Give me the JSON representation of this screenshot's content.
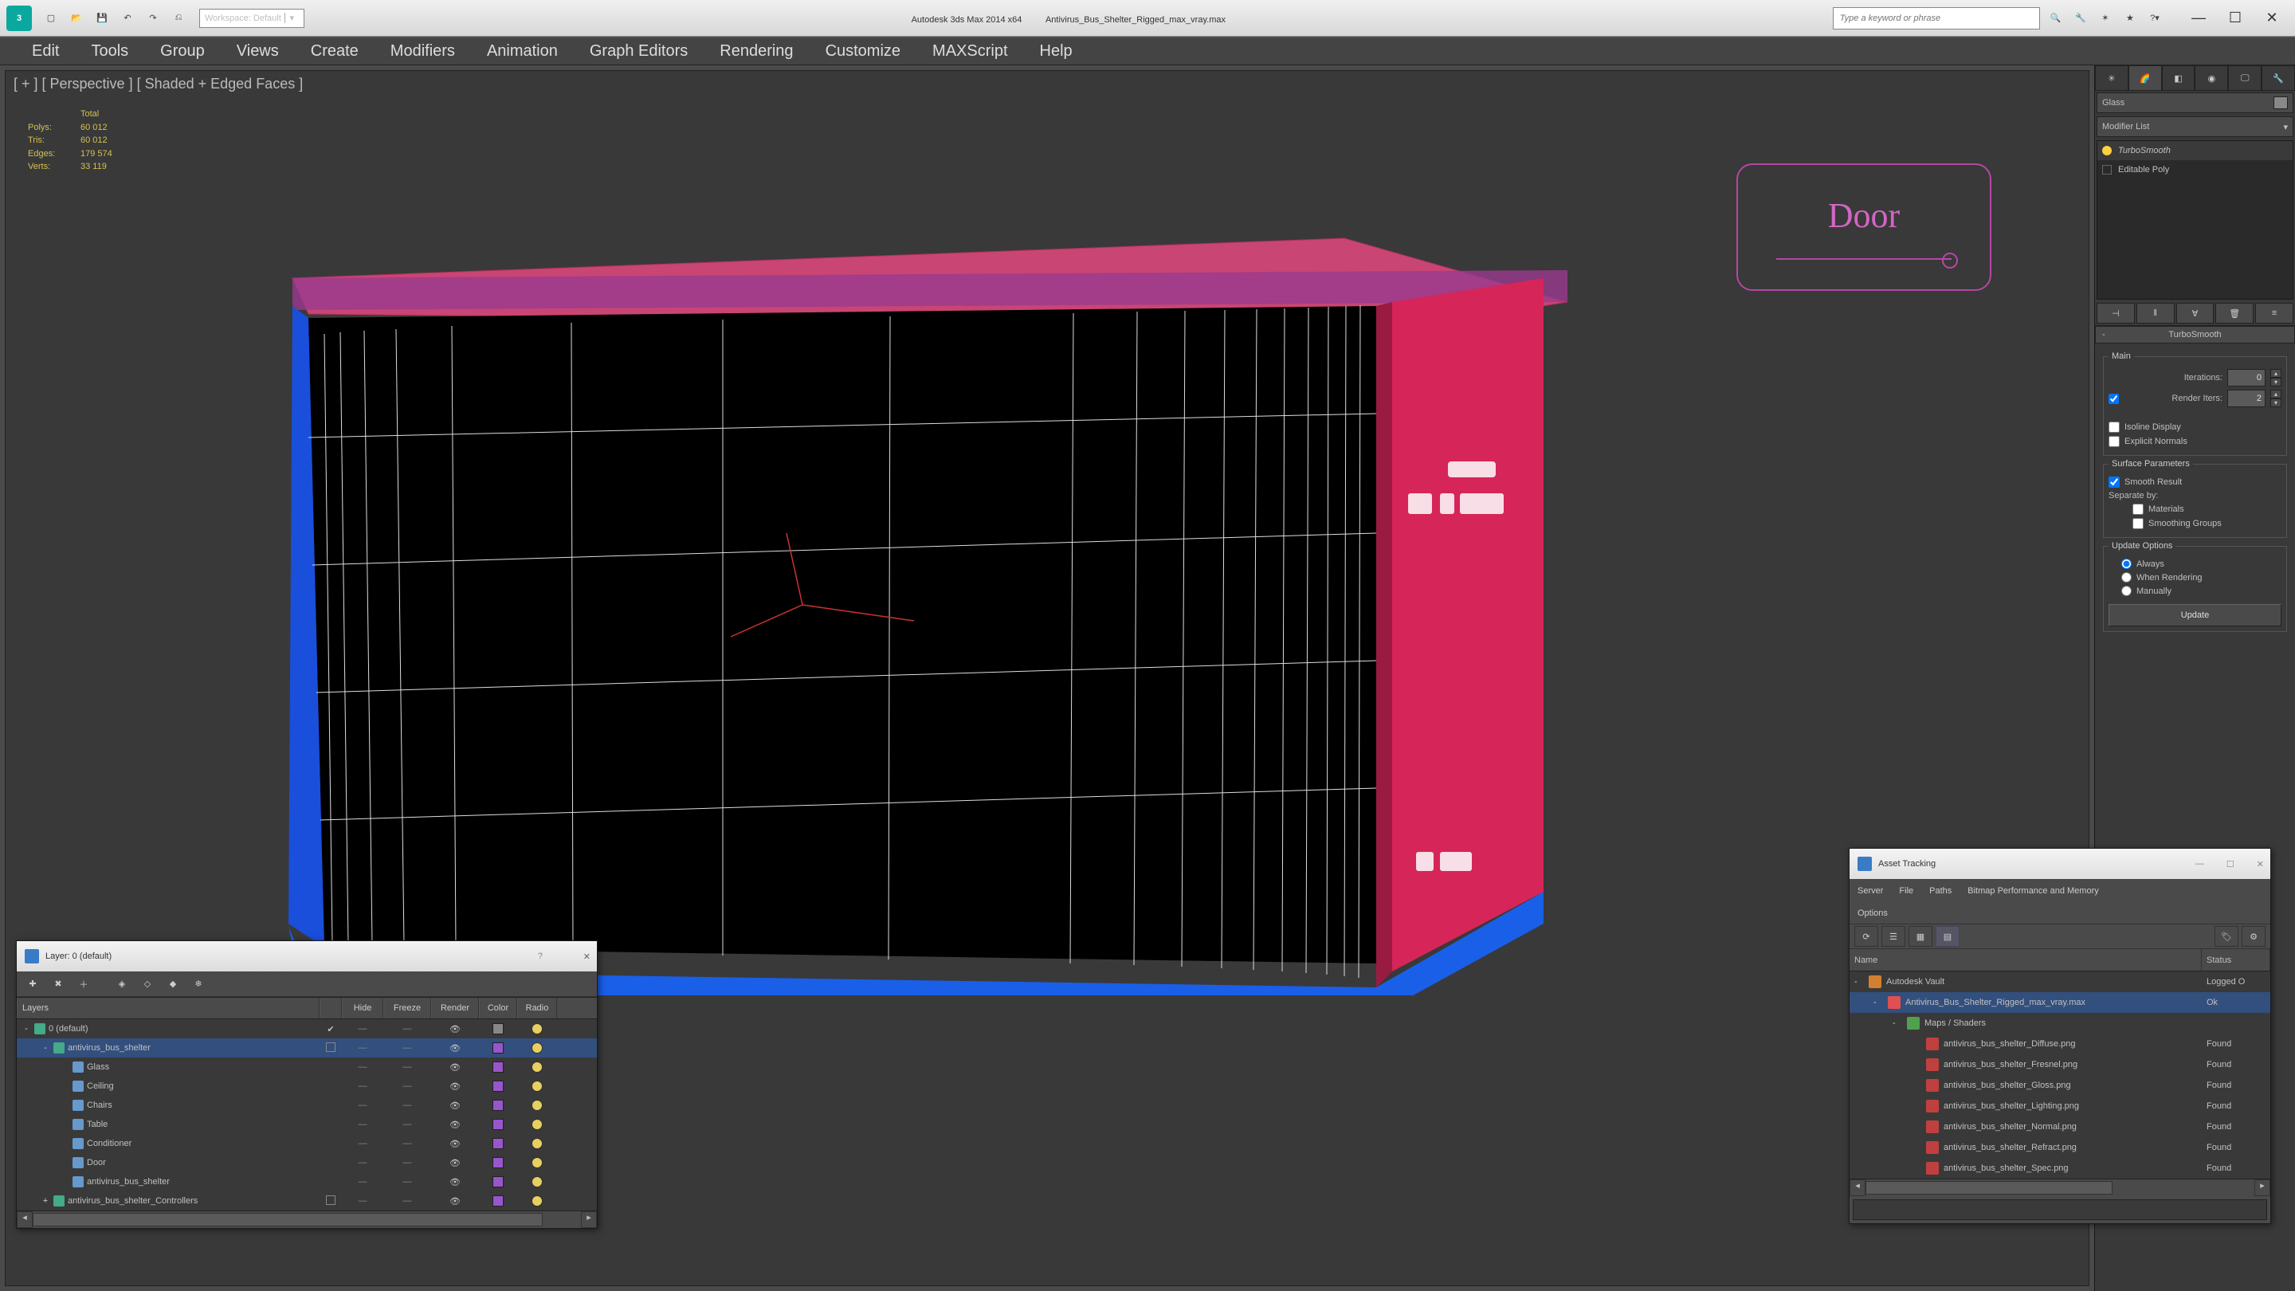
{
  "titlebar": {
    "workspace_selector": "Workspace: Default",
    "app_name": "Autodesk 3ds Max  2014 x64",
    "file_name": "Antivirus_Bus_Shelter_Rigged_max_vray.max",
    "search_placeholder": "Type a keyword or phrase"
  },
  "menubar": [
    "Edit",
    "Tools",
    "Group",
    "Views",
    "Create",
    "Modifiers",
    "Animation",
    "Graph Editors",
    "Rendering",
    "Customize",
    "MAXScript",
    "Help"
  ],
  "viewport": {
    "label": "[ + ] [ Perspective ] [ Shaded + Edged Faces ]",
    "stats_header": "Total",
    "stats": [
      {
        "label": "Polys:",
        "value": "60 012"
      },
      {
        "label": "Tris:",
        "value": "60 012"
      },
      {
        "label": "Edges:",
        "value": "179 574"
      },
      {
        "label": "Verts:",
        "value": "33 119"
      }
    ],
    "viewcube_label": "Door"
  },
  "cmdpanel": {
    "object_name": "Glass",
    "modifier_list_label": "Modifier List",
    "mod_stack": [
      {
        "name": "TurboSmooth",
        "selected": true,
        "italic": true
      },
      {
        "name": "Editable Poly",
        "selected": false,
        "italic": false
      }
    ],
    "rollout_title": "TurboSmooth",
    "main_group": "Main",
    "iterations_label": "Iterations:",
    "iterations_value": "0",
    "render_iters_label": "Render Iters:",
    "render_iters_value": "2",
    "render_iters_checked": true,
    "isoline_label": "Isoline Display",
    "explicit_label": "Explicit Normals",
    "surface_group": "Surface Parameters",
    "smooth_result_label": "Smooth Result",
    "smooth_result_checked": true,
    "separate_label": "Separate by:",
    "materials_label": "Materials",
    "smoothing_groups_label": "Smoothing Groups",
    "update_group": "Update Options",
    "radio_always": "Always",
    "radio_when": "When Rendering",
    "radio_manual": "Manually",
    "update_button": "Update"
  },
  "layers": {
    "title": "Layer: 0 (default)",
    "columns": [
      "Layers",
      "",
      "Hide",
      "Freeze",
      "Render",
      "Color",
      "Radio"
    ],
    "rows": [
      {
        "indent": 0,
        "expand": "-",
        "name": "0 (default)",
        "flagged": true,
        "selected": false,
        "color": "#888888"
      },
      {
        "indent": 1,
        "expand": "-",
        "name": "antivirus_bus_shelter",
        "flagged": false,
        "selected": true,
        "hasbox": true,
        "color": "#9955cc"
      },
      {
        "indent": 2,
        "expand": "",
        "name": "Glass",
        "color": "#9955cc"
      },
      {
        "indent": 2,
        "expand": "",
        "name": "Ceiling",
        "color": "#9955cc"
      },
      {
        "indent": 2,
        "expand": "",
        "name": "Chairs",
        "color": "#9955cc"
      },
      {
        "indent": 2,
        "expand": "",
        "name": "Table",
        "color": "#9955cc"
      },
      {
        "indent": 2,
        "expand": "",
        "name": "Conditioner",
        "color": "#9955cc"
      },
      {
        "indent": 2,
        "expand": "",
        "name": "Door",
        "color": "#9955cc"
      },
      {
        "indent": 2,
        "expand": "",
        "name": "antivirus_bus_shelter",
        "color": "#9955cc"
      },
      {
        "indent": 1,
        "expand": "+",
        "name": "antivirus_bus_shelter_Controllers",
        "hasbox": true,
        "color": "#9955cc"
      }
    ]
  },
  "assets": {
    "title": "Asset Tracking",
    "menus": [
      "Server",
      "File",
      "Paths",
      "Bitmap Performance and Memory",
      "Options"
    ],
    "columns": [
      "Name",
      "Status"
    ],
    "rows": [
      {
        "indent": 0,
        "icon": "vault",
        "name": "Autodesk Vault",
        "status": "Logged O",
        "selected": false
      },
      {
        "indent": 1,
        "icon": "max",
        "name": "Antivirus_Bus_Shelter_Rigged_max_vray.max",
        "status": "Ok",
        "selected": true
      },
      {
        "indent": 2,
        "icon": "folder",
        "name": "Maps / Shaders",
        "status": "",
        "selected": false
      },
      {
        "indent": 3,
        "icon": "img",
        "name": "antivirus_bus_shelter_Diffuse.png",
        "status": "Found"
      },
      {
        "indent": 3,
        "icon": "img",
        "name": "antivirus_bus_shelter_Fresnel.png",
        "status": "Found"
      },
      {
        "indent": 3,
        "icon": "img",
        "name": "antivirus_bus_shelter_Gloss.png",
        "status": "Found"
      },
      {
        "indent": 3,
        "icon": "img",
        "name": "antivirus_bus_shelter_Lighting.png",
        "status": "Found"
      },
      {
        "indent": 3,
        "icon": "img",
        "name": "antivirus_bus_shelter_Normal.png",
        "status": "Found"
      },
      {
        "indent": 3,
        "icon": "img",
        "name": "antivirus_bus_shelter_Refract.png",
        "status": "Found"
      },
      {
        "indent": 3,
        "icon": "img",
        "name": "antivirus_bus_shelter_Spec.png",
        "status": "Found"
      }
    ]
  }
}
